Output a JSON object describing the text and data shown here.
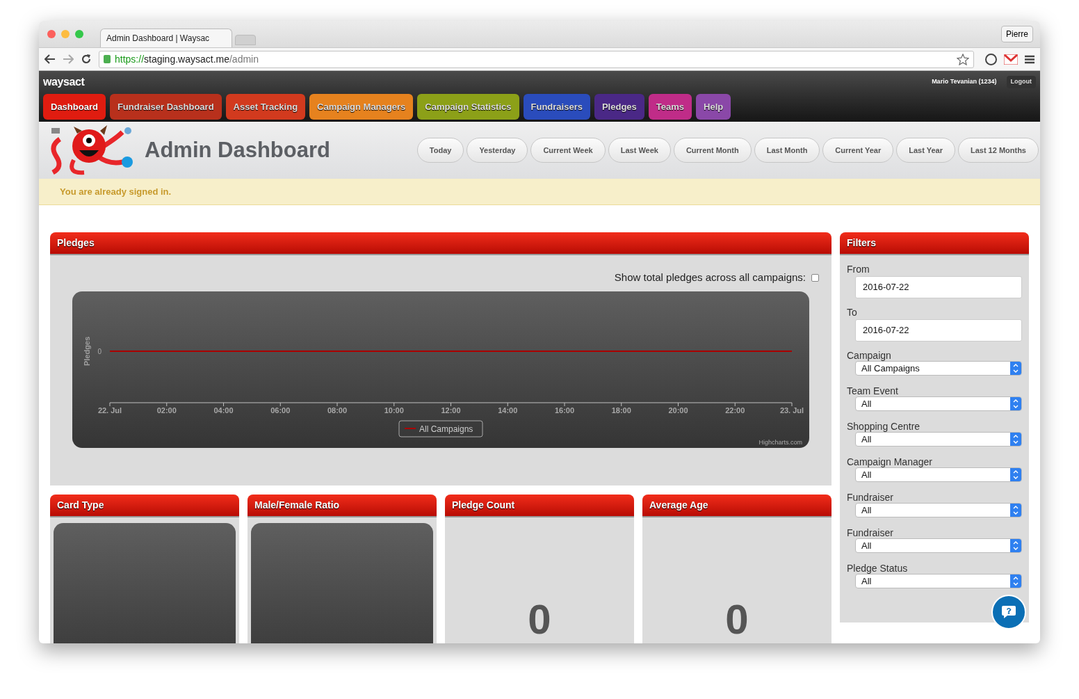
{
  "browser": {
    "tab_title": "Admin Dashboard | Waysac",
    "profile": "Pierre",
    "url": {
      "scheme": "https://",
      "host": "staging.waysact.me",
      "path": "/admin"
    }
  },
  "app": {
    "brand": "waysact",
    "user": "Mario Tevanian (1234)",
    "logout": "Logout",
    "nav": [
      {
        "label": "Dashboard",
        "color": "#e01c10",
        "selected": true
      },
      {
        "label": "Fundraiser Dashboard",
        "color": "#b8301c",
        "selected": false
      },
      {
        "label": "Asset Tracking",
        "color": "#d23a1e",
        "selected": false
      },
      {
        "label": "Campaign Managers",
        "color": "#e6821e",
        "selected": false
      },
      {
        "label": "Campaign Statistics",
        "color": "#8ca018",
        "selected": false
      },
      {
        "label": "Fundraisers",
        "color": "#2a4cbc",
        "selected": false
      },
      {
        "label": "Pledges",
        "color": "#4a2886",
        "selected": false
      },
      {
        "label": "Teams",
        "color": "#c02c88",
        "selected": false
      },
      {
        "label": "Help",
        "color": "#8a48a8",
        "selected": false
      }
    ]
  },
  "page": {
    "title": "Admin Dashboard",
    "ranges": [
      {
        "label": "Today",
        "selected": false
      },
      {
        "label": "Yesterday",
        "selected": false
      },
      {
        "label": "Current Week",
        "selected": false
      },
      {
        "label": "Last Week",
        "selected": false
      },
      {
        "label": "Current Month",
        "selected": false
      },
      {
        "label": "Last Month",
        "selected": false
      },
      {
        "label": "Current Year",
        "selected": false
      },
      {
        "label": "Last Year",
        "selected": false
      },
      {
        "label": "Last 12 Months",
        "selected": false
      }
    ],
    "alert": "You are already signed in."
  },
  "pledges": {
    "title": "Pledges",
    "toggle": {
      "label": "Show total pledges across all campaigns:",
      "checked": false
    },
    "credits": "Highcharts.com",
    "chart": {
      "y_title": "Pledges",
      "y_tick": "0",
      "x_labels": [
        "22. Jul",
        "02:00",
        "04:00",
        "06:00",
        "08:00",
        "10:00",
        "12:00",
        "14:00",
        "16:00",
        "18:00",
        "20:00",
        "22:00",
        "23. Jul"
      ],
      "legend": [
        "All Campaigns"
      ]
    }
  },
  "cards": [
    {
      "title": "Card Type",
      "kind": "chart"
    },
    {
      "title": "Male/Female Ratio",
      "kind": "chart"
    },
    {
      "title": "Pledge Count",
      "kind": "number",
      "value": "0"
    },
    {
      "title": "Average Age",
      "kind": "number",
      "value": "0"
    }
  ],
  "filters": {
    "title": "Filters",
    "fields": [
      {
        "label": "From",
        "kind": "date",
        "value": "2016-07-22"
      },
      {
        "label": "To",
        "kind": "date",
        "value": "2016-07-22"
      },
      {
        "label": "Campaign",
        "kind": "select",
        "value": "All Campaigns"
      },
      {
        "label": "Team Event",
        "kind": "select",
        "value": "All"
      },
      {
        "label": "Shopping Centre",
        "kind": "select",
        "value": "All"
      },
      {
        "label": "Campaign Manager",
        "kind": "select",
        "value": "All"
      },
      {
        "label": "Fundraiser",
        "kind": "select",
        "value": "All"
      },
      {
        "label": "Fundraiser",
        "kind": "select",
        "value": "All"
      },
      {
        "label": "Pledge Status",
        "kind": "select",
        "value": "All"
      }
    ]
  }
}
